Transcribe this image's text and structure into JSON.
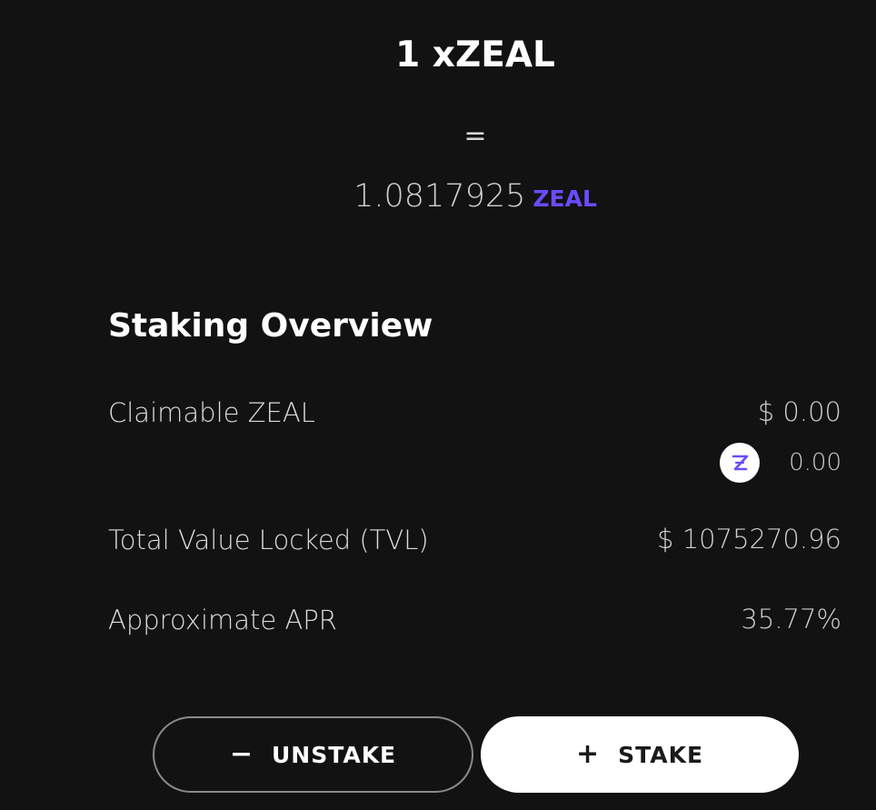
{
  "rate": {
    "title": "1 xZEAL",
    "equals": "=",
    "value": "1.0817925",
    "token": "ZEAL"
  },
  "overview": {
    "title": "Staking Overview",
    "claimable": {
      "label": "Claimable ZEAL",
      "usd_value": "$ 0.00",
      "token_amount": "0.00",
      "icon": "zeal-token-icon"
    },
    "tvl": {
      "label": "Total Value Locked (TVL)",
      "value": "$ 1075270.96"
    },
    "apr": {
      "label": "Approximate APR",
      "value": "35.77%"
    }
  },
  "actions": {
    "unstake": {
      "symbol": "−",
      "label": "UNSTAKE",
      "icon": "minus-icon"
    },
    "stake": {
      "symbol": "+",
      "label": "STAKE",
      "icon": "plus-icon"
    }
  },
  "colors": {
    "background": "#121213",
    "accent": "#6b4bff",
    "text": "#ffffff",
    "muted_text": "#cfcfcf"
  }
}
